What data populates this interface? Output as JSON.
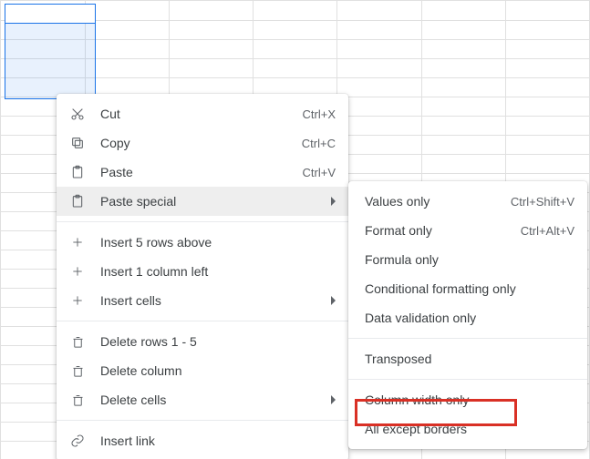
{
  "selection": {
    "active_cell": "A1",
    "range": "A1:A5"
  },
  "menu": {
    "cut": {
      "label": "Cut",
      "shortcut": "Ctrl+X"
    },
    "copy": {
      "label": "Copy",
      "shortcut": "Ctrl+C"
    },
    "paste": {
      "label": "Paste",
      "shortcut": "Ctrl+V"
    },
    "paste_special": {
      "label": "Paste special"
    },
    "insert_rows": {
      "label": "Insert 5 rows above"
    },
    "insert_col": {
      "label": "Insert 1 column left"
    },
    "insert_cells": {
      "label": "Insert cells"
    },
    "delete_rows": {
      "label": "Delete rows 1 - 5"
    },
    "delete_col": {
      "label": "Delete column"
    },
    "delete_cells": {
      "label": "Delete cells"
    },
    "insert_link": {
      "label": "Insert link"
    }
  },
  "submenu": {
    "values_only": {
      "label": "Values only",
      "shortcut": "Ctrl+Shift+V"
    },
    "format_only": {
      "label": "Format only",
      "shortcut": "Ctrl+Alt+V"
    },
    "formula_only": {
      "label": "Formula only"
    },
    "cond_fmt": {
      "label": "Conditional formatting only"
    },
    "data_val": {
      "label": "Data validation only"
    },
    "transposed": {
      "label": "Transposed"
    },
    "col_width": {
      "label": "Column width only"
    },
    "all_except": {
      "label": "All except borders"
    }
  },
  "highlighted_item": "col_width"
}
